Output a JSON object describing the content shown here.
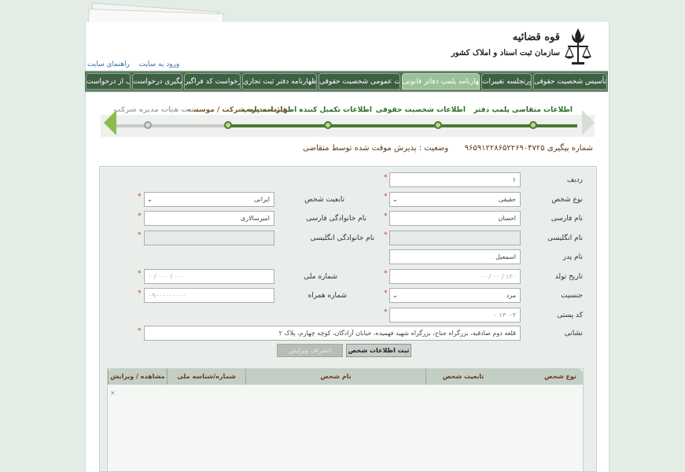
{
  "header": {
    "logo_line1": "قوه قضائیه",
    "logo_line2": "سازمان ثبت اسناد و املاک کشور",
    "links": [
      "ورود به سایت",
      "راهنمای سایت"
    ]
  },
  "nav": {
    "items": [
      {
        "label": "تأسیس شخصیت حقوقی",
        "active": false
      },
      {
        "label": "صورتجلسه تغییرات",
        "active": false
      },
      {
        "label": "پذیرش اظهارنامه پلمپ دفاتر قانونی",
        "active": true
      },
      {
        "label": "اطلاعات عمومی شخصیت حقوقی",
        "active": false
      },
      {
        "label": "اظهارنامه دفتر ثبت تجاری",
        "active": false
      },
      {
        "label": "درخواست کد فراگیر",
        "active": false
      },
      {
        "label": "پیگیری درخواست",
        "active": false
      },
      {
        "label": "انصراف از درخواست",
        "active": false
      }
    ]
  },
  "wizard": {
    "steps": [
      {
        "label": "اطلاعات متقاضی پلمپ دفتر",
        "state": "done"
      },
      {
        "label": "اطلاعات شخصیت حقوقی",
        "state": "done"
      },
      {
        "label": "اطلاعات تکمیل کننده اظهارنامه پلمپ",
        "state": "done"
      },
      {
        "label": "هیئت مدیره شرکت / موسسه",
        "state": "current"
      },
      {
        "label": "ثبت هیات مدیره شرکت",
        "state": "todo"
      }
    ]
  },
  "status": {
    "tracking_label": "شماره پیگیری",
    "tracking_number": "۹۶۵۹۱۲۲۸۶۵۲۲۶۹۰۴۷۲۵",
    "state_label": "وضعیت :",
    "state_value": "پذیرش موقت شده توسط متقاضی"
  },
  "form": {
    "row_label": "ردیف",
    "row_value": "۱",
    "person_type_label": "نوع شخص",
    "person_type_value": "حقیقی",
    "nationality_label": "تابعیت شخص",
    "nationality_value": "ایرانی",
    "first_name_fa_label": "نام فارسی",
    "first_name_fa_value": "احسان",
    "last_name_fa_label": "نام خانوادگی فارسی",
    "last_name_fa_value": "امیرسالاری",
    "first_name_en_label": "نام انگلیسی",
    "last_name_en_label": "نام خانوادگی انگلیسی",
    "father_name_label": "نام پدر",
    "father_name_value": "اسمعیل",
    "birth_date_label": "تاریخ تولد",
    "birth_date_value": "۱۳۰ / ۰۰ / ۰۰",
    "national_id_label": "شماره ملی",
    "national_id_value": "۰ / ۰۰۰ / ۰۰۰",
    "gender_label": "جنسیت",
    "gender_value": "مرد",
    "mobile_label": "شماره همراه",
    "mobile_value": "۰۹۰۰۰۰۰۰۰۰۰",
    "postal_code_label": "کد پستی",
    "postal_code_value": "۱۳۰۰۳ ۰",
    "address_label": "نشانی",
    "address_value": "قلعه دوم صادقیه، بزرگراه جناح، بزرگراه شهید فهمیده، خیابان آزادگان، کوچه چهارم، پلاک ۲",
    "submit_label": "ثبت اطلاعات شخص",
    "cancel_label": "انصراف ویرایش"
  },
  "grid": {
    "columns": [
      "نوع شخص",
      "تابعیت شخص",
      "نام شخص",
      "شماره/شناسه ملی",
      "مشاهده / ویرایش"
    ],
    "empty_mark": "×"
  },
  "colors": {
    "nav_bg": "#4a6b4f",
    "nav_active": "#9cc09a",
    "step_done": "#4a7a2f",
    "required": "#d9302b"
  }
}
